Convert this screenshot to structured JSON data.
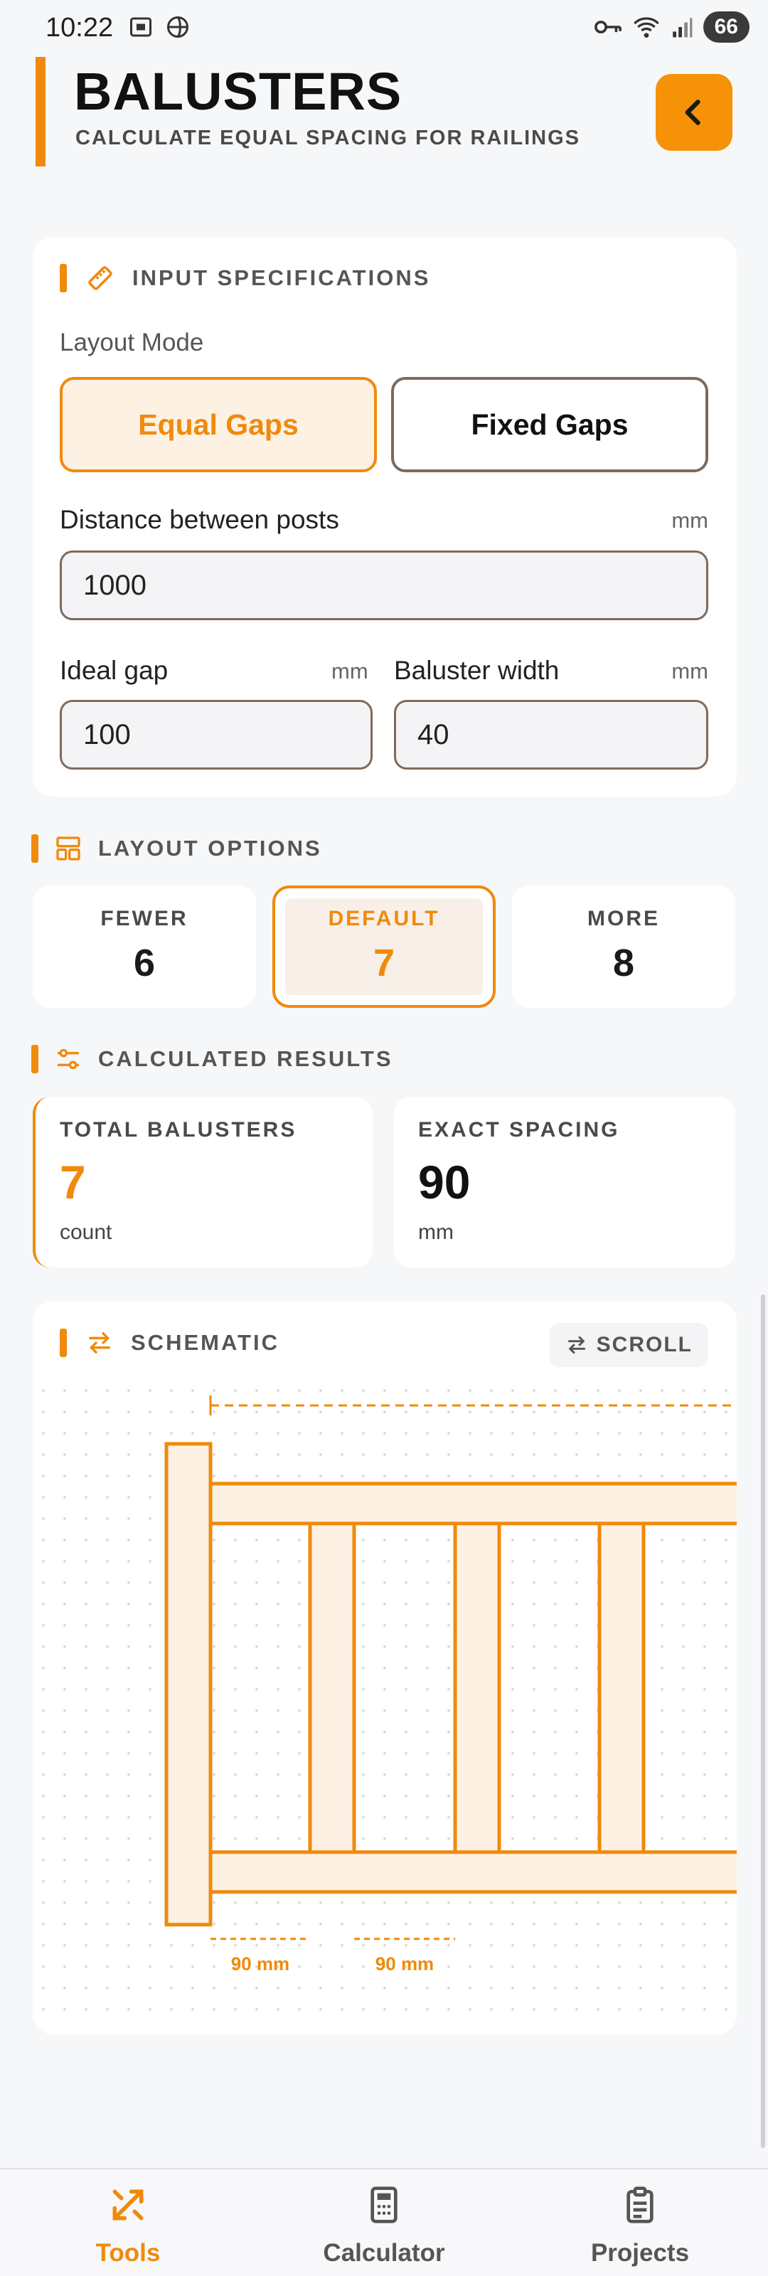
{
  "status_bar": {
    "time": "10:22",
    "battery": "66"
  },
  "header": {
    "title": "BALUSTERS",
    "subtitle": "CALCULATE EQUAL SPACING FOR RAILINGS",
    "back_icon": "chevron-left-icon"
  },
  "colors": {
    "accent": "#f08a0c",
    "accent_light": "#fdf1e4",
    "background": "#f6f7f9"
  },
  "input_specs": {
    "title": "INPUT SPECIFICATIONS",
    "layout_mode_label": "Layout Mode",
    "modes": [
      {
        "label": "Equal Gaps",
        "selected": true
      },
      {
        "label": "Fixed Gaps",
        "selected": false
      }
    ],
    "distance_label": "Distance between posts",
    "distance_unit": "mm",
    "distance_value": "1000",
    "gap_label": "Ideal gap",
    "gap_unit": "mm",
    "gap_value": "100",
    "width_label": "Baluster width",
    "width_unit": "mm",
    "width_value": "40"
  },
  "layout_options": {
    "title": "LAYOUT OPTIONS",
    "options": [
      {
        "label": "FEWER",
        "value": "6",
        "selected": false
      },
      {
        "label": "DEFAULT",
        "value": "7",
        "selected": true
      },
      {
        "label": "MORE",
        "value": "8",
        "selected": false
      }
    ]
  },
  "results": {
    "title": "CALCULATED RESULTS",
    "total_label": "TOTAL BALUSTERS",
    "total_value": "7",
    "total_unit": "count",
    "spacing_label": "EXACT SPACING",
    "spacing_value": "90",
    "spacing_unit": "mm"
  },
  "schematic": {
    "title": "SCHEMATIC",
    "scroll_label": "SCROLL",
    "gap_labels": [
      "90 mm",
      "90 mm"
    ]
  },
  "nav": {
    "items": [
      {
        "label": "Tools",
        "icon": "tools-icon",
        "active": true
      },
      {
        "label": "Calculator",
        "icon": "calculator-icon",
        "active": false
      },
      {
        "label": "Projects",
        "icon": "clipboard-icon",
        "active": false
      }
    ]
  }
}
